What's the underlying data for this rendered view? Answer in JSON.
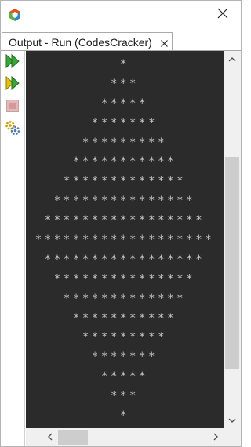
{
  "window": {
    "icons": {
      "app": "netbeans-cube-icon",
      "close": "close-icon"
    }
  },
  "tab": {
    "label": "Output - Run (CodesCracker)",
    "close_icon": "tab-close-icon"
  },
  "toolbar": {
    "items": [
      {
        "name": "rerun-icon",
        "enabled": true,
        "color": "#2e9b2e"
      },
      {
        "name": "rerun-with-options-icon",
        "enabled": true,
        "color": "#d4b800"
      },
      {
        "name": "stop-icon",
        "enabled": false,
        "color": "#d9a3a3"
      },
      {
        "name": "settings-icon",
        "enabled": true,
        "color": "#5a7fa8"
      }
    ]
  },
  "output": {
    "background": "#2b2b2b",
    "text_color": "#c8c8c8",
    "lines": [
      "*",
      "***",
      "*****",
      "*******",
      "*********",
      "***********",
      "*************",
      "***************",
      "*****************",
      "*******************",
      "*****************",
      "***************",
      "*************",
      "***********",
      "*********",
      "*******",
      "*****",
      "***",
      "*"
    ]
  },
  "scrollbars": {
    "vertical": {
      "up_icon": "chevron-up-icon",
      "down_icon": "chevron-down-icon"
    },
    "horizontal": {
      "left_icon": "chevron-left-icon",
      "right_icon": "chevron-right-icon"
    }
  }
}
